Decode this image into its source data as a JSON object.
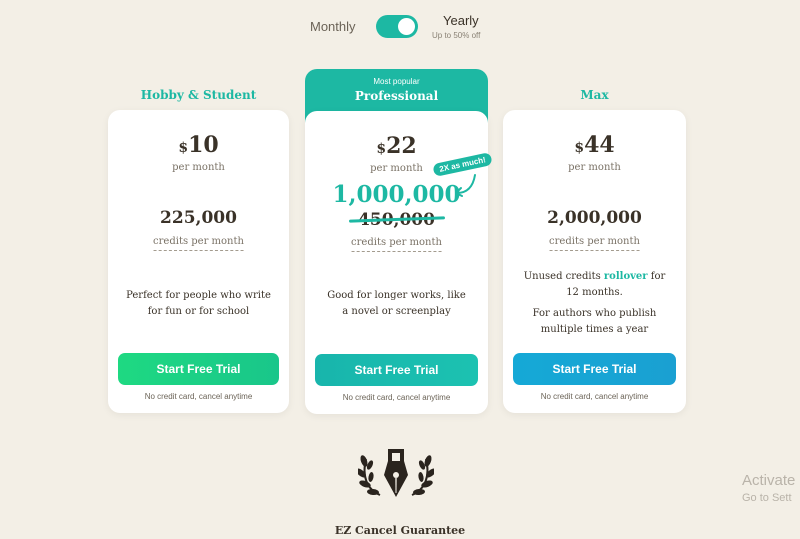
{
  "billing": {
    "monthly_label": "Monthly",
    "yearly_label": "Yearly",
    "yearly_discount": "Up to 50% off",
    "selected": "yearly"
  },
  "plans": [
    {
      "title": "Hobby & Student",
      "currency": "$",
      "price": "10",
      "period": "per month",
      "credits": "225,000",
      "credits_label": "credits per month",
      "description_lines": [
        "Perfect for people who write",
        "for fun or for school"
      ],
      "cta": "Start Free Trial",
      "note": "No credit card, cancel anytime"
    },
    {
      "banner_small": "Most popular",
      "title": "Professional",
      "currency": "$",
      "price": "22",
      "period": "per month",
      "credits": "1,000,000",
      "old_credits": "450,000",
      "badge": "2X as much!",
      "credits_label": "credits per month",
      "description_lines": [
        "Good for longer works, like",
        "a novel or screenplay"
      ],
      "cta": "Start Free Trial",
      "note": "No credit card, cancel anytime"
    },
    {
      "title": "Max",
      "currency": "$",
      "price": "44",
      "period": "per month",
      "credits": "2,000,000",
      "credits_label": "credits per month",
      "rollover_pre": "Unused credits ",
      "rollover_word": "rollover",
      "rollover_post": " for",
      "rollover_line2": "12 months.",
      "description_lines": [
        "For authors who publish",
        "multiple times a year"
      ],
      "cta": "Start Free Trial",
      "note": "No credit card, cancel anytime"
    }
  ],
  "guarantee": {
    "label": "EZ Cancel Guarantee",
    "icon": "laurel-pen-icon"
  },
  "watermark": {
    "title": "Activate",
    "subtitle": "Go to Sett"
  },
  "colors": {
    "accent": "#1db8a3",
    "background": "#f3efe6",
    "green": "#1ed982",
    "blue": "#15a9d6"
  }
}
